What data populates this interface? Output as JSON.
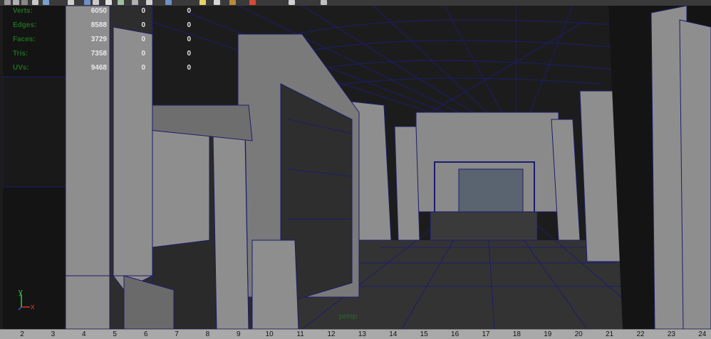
{
  "toolbar": {
    "icons": [
      "move-tool-icon",
      "rotate-tool-icon",
      "scale-tool-icon",
      "snap-icon",
      "grid-icon",
      "camera-icon",
      "wireframe-icon",
      "shaded-icon",
      "texture-icon",
      "light-icon",
      "xray-icon",
      "isolate-icon",
      "display-icon",
      "sphere-icon",
      "light-bulb-icon",
      "material-icon",
      "select-icon",
      "component-icon",
      "hierarchy-icon"
    ]
  },
  "hud": {
    "rows": [
      {
        "label": "Verts:",
        "v1": "6050",
        "v2": "0",
        "v3": "0"
      },
      {
        "label": "Edges:",
        "v1": "8588",
        "v2": "0",
        "v3": "0"
      },
      {
        "label": "Faces:",
        "v1": "3729",
        "v2": "0",
        "v3": "0"
      },
      {
        "label": "Tris:",
        "v1": "7358",
        "v2": "0",
        "v3": "0"
      },
      {
        "label": "UVs:",
        "v1": "9468",
        "v2": "0",
        "v3": "0"
      }
    ]
  },
  "viewport": {
    "camera": "persp"
  },
  "axis": {
    "y_label": "y",
    "x_label": "x"
  },
  "timeline": {
    "ticks": [
      "2",
      "3",
      "4",
      "5",
      "6",
      "7",
      "8",
      "9",
      "10",
      "11",
      "12",
      "13",
      "14",
      "15",
      "16",
      "17",
      "18",
      "19",
      "20",
      "21",
      "22",
      "23",
      "24"
    ]
  },
  "colors": {
    "wire": "#1a1a6a",
    "wall": "#8e8e8e",
    "floor": "#2f2f2f",
    "ceiling": "#1b1b1b"
  }
}
